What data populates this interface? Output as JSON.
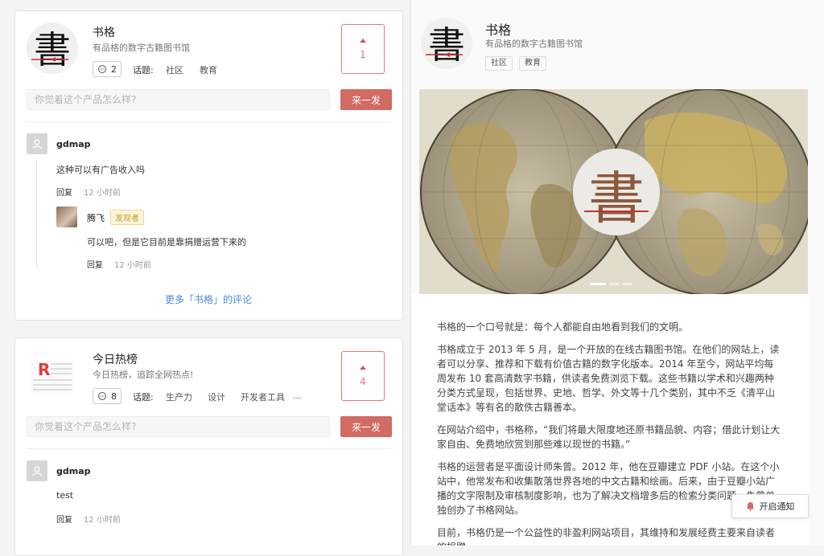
{
  "colors": {
    "accent": "#d16b63",
    "link": "#4f8ad8",
    "badge": "#c99a2e"
  },
  "card1": {
    "name": "书格",
    "subtitle": "有品格的数字古籍图书馆",
    "comment_count": "2",
    "topics_label": "话题:",
    "topics": [
      "社区",
      "教育"
    ],
    "votes": "1",
    "input_placeholder": "你觉着这个产品怎么样?",
    "submit_label": "来一发",
    "comments": [
      {
        "user": "gdmap",
        "text": "这种可以有广告收入吗",
        "reply": "回复",
        "time": "12 小时前"
      }
    ],
    "reply": {
      "user": "腾飞",
      "badge": "发现者",
      "text": "可以吧，但是它目前是靠捐赠运营下来的",
      "reply": "回复",
      "time": "12 小时前"
    },
    "more_link": "更多「书格」的评论"
  },
  "card2": {
    "name": "今日热榜",
    "subtitle": "今日热榜，追踪全网热点!",
    "comment_count": "8",
    "topics_label": "话题:",
    "topics": [
      "生产力",
      "设计",
      "开发者工具",
      "..."
    ],
    "votes": "4",
    "input_placeholder": "你觉着这个产品怎么样?",
    "submit_label": "来一发",
    "comments": [
      {
        "user": "gdmap",
        "text": "test",
        "reply": "回复",
        "time": "12 小时前"
      }
    ]
  },
  "detail": {
    "name": "书格",
    "subtitle": "有品格的数字古籍图书馆",
    "tags": [
      "社区",
      "教育"
    ],
    "paragraphs": [
      "书格的一个口号就是：每个人都能自由地看到我们的文明。",
      "书格成立于 2013 年 5 月，是一个开放的在线古籍图书馆。在他们的网站上，读者可以分享、推荐和下载有价值古籍的数字化版本。2014 年至今，网站平均每周发布 10 套高清数字书籍，供读者免费浏览下载。这些书籍以学术和兴趣两种分类方式呈现，包括世界、史地、哲学、外文等十几个类别，其中不乏《清平山堂话本》等有名的散佚古籍善本。",
      "在网站介绍中，书格称，“我们将最大限度地还原书籍品貌、内容；借此计划让大家自由、免费地欣赏到那些难以现世的书籍。”",
      "书格的运营者是平面设计师朱曾。2012 年，他在豆瓣建立 PDF 小站。在这个小站中，他常发布和收集散落世界各地的中文古籍和绘画。后来，由于豆瓣小站广播的文字限制及审核制度影响，也为了解决文档增多后的检索分类问题，朱曾单独创办了书格网站。",
      "目前，书格仍是一个公益性的非盈利网站项目，其维持和发展经费主要来自读者的捐赠。"
    ],
    "logo_char": "書",
    "notify_label": "开启通知"
  }
}
